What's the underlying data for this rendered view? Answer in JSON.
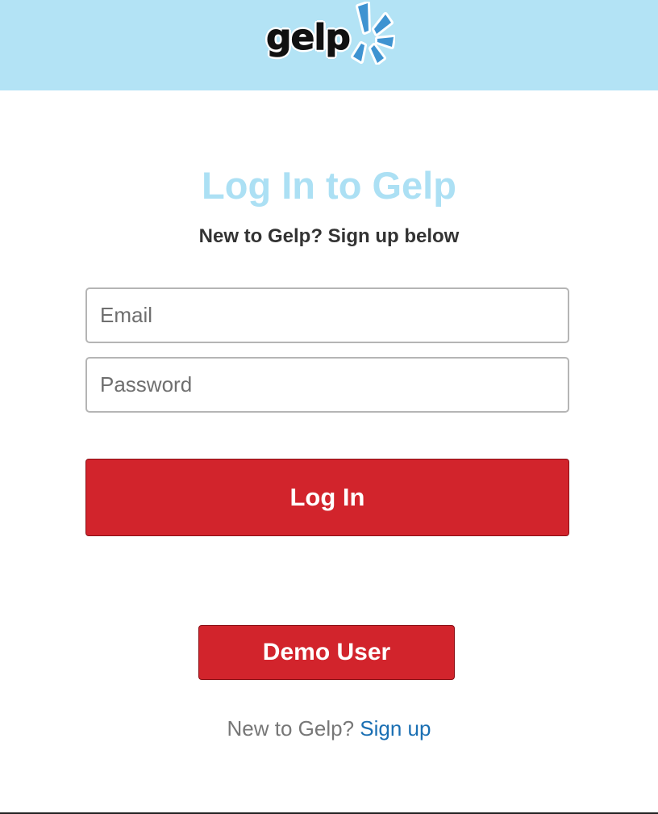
{
  "header": {
    "logo_text": "gelp",
    "background_color": "#b3e3f5",
    "logo_burst_color": "#3e93d1"
  },
  "main": {
    "title": "Log In to Gelp",
    "subtitle": "New to Gelp? Sign up below",
    "email_placeholder": "Email",
    "email_value": "",
    "password_placeholder": "Password",
    "password_value": "",
    "login_button_label": "Log In",
    "demo_button_label": "Demo User",
    "signup_prompt": "New to Gelp?",
    "signup_link_label": "Sign up",
    "title_color": "#ace0f4",
    "button_color": "#d2242c",
    "link_color": "#1a6fb3"
  }
}
